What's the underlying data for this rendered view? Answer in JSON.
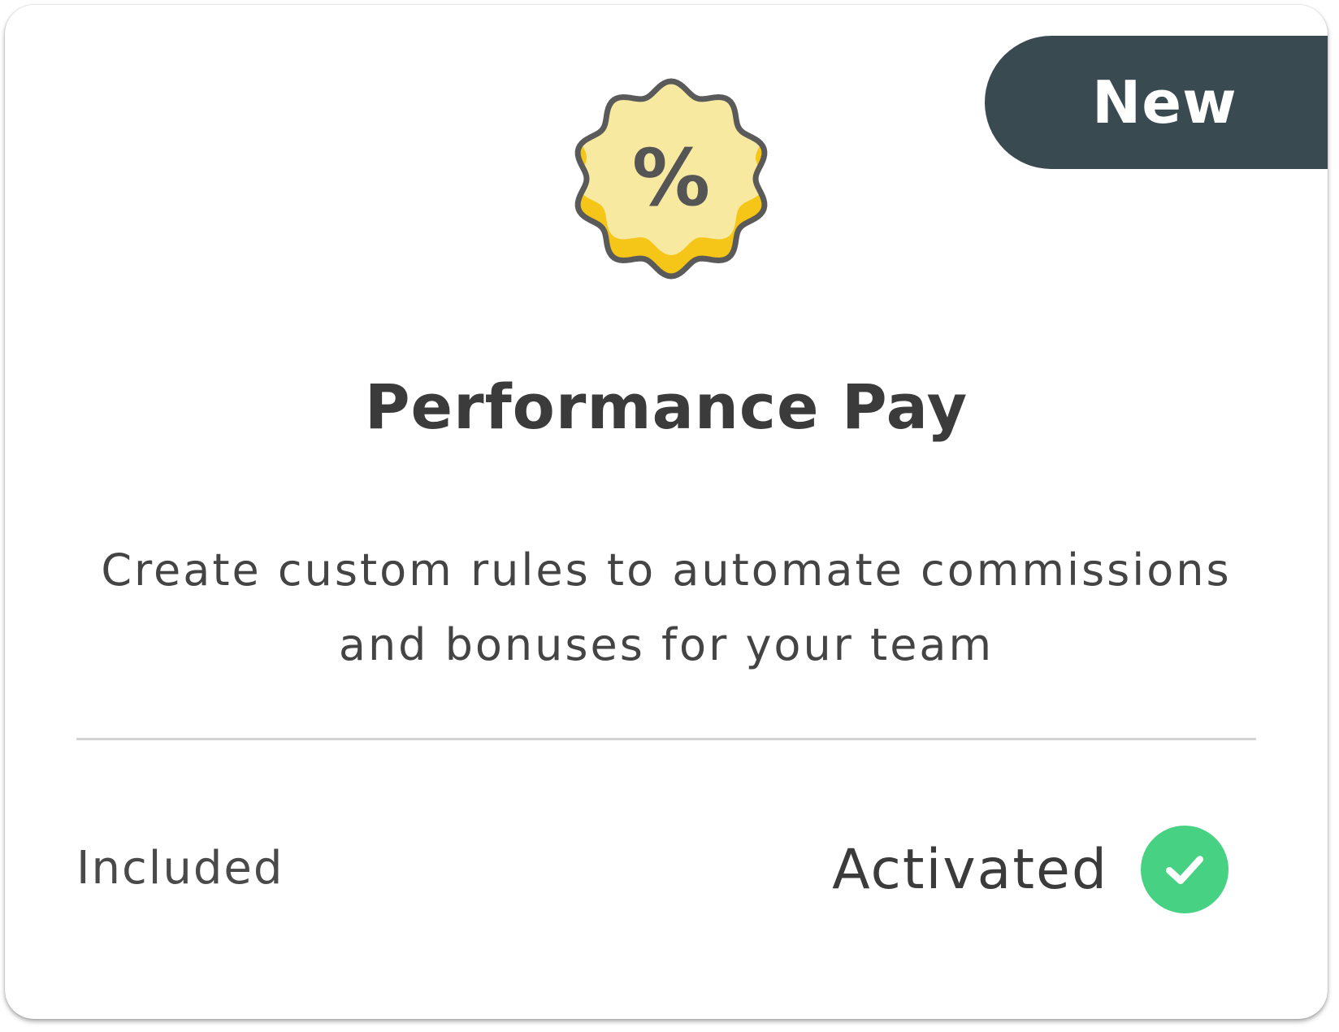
{
  "badge": {
    "label": "New"
  },
  "icon": {
    "name": "percent-badge-icon",
    "glyph": "%",
    "fill": "#f7e9a0",
    "accent": "#f5c518",
    "stroke": "#5a5a5a"
  },
  "card": {
    "title": "Performance Pay",
    "description": "Create custom rules to automate commissions and bonuses for your team",
    "plan_label": "Included",
    "status_label": "Activated",
    "status_color": "#47d182"
  },
  "colors": {
    "badge_bg": "#3a4a51",
    "text": "#3b3b3b"
  }
}
